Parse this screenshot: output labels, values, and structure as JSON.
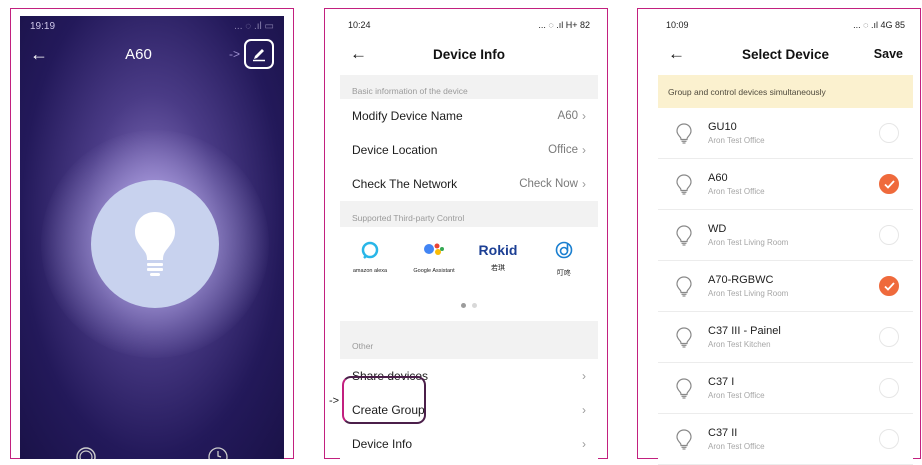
{
  "screen1": {
    "status_time": "19:19",
    "title": "A60",
    "arrow_note": "->"
  },
  "screen2": {
    "status_time": "10:24",
    "status_right": "... ◌ .ıl H+ 82",
    "title": "Device Info",
    "section_basic": "Basic information of the device",
    "rows_basic": [
      {
        "label": "Modify Device Name",
        "value": "A60"
      },
      {
        "label": "Device Location",
        "value": "Office"
      },
      {
        "label": "Check The Network",
        "value": "Check Now"
      }
    ],
    "section_third": "Supported Third-party Control",
    "third_party": [
      {
        "caption": "amazon alexa"
      },
      {
        "caption": "Google Assistant"
      },
      {
        "logo": "Rokid",
        "caption": "若琪"
      },
      {
        "caption": "叮咚"
      }
    ],
    "section_other": "Other",
    "rows_other": [
      {
        "label": "Share devices"
      },
      {
        "label": "Create Group"
      },
      {
        "label": "Device Info"
      }
    ],
    "arrow_note": "->"
  },
  "screen3": {
    "status_time": "10:09",
    "status_right": "... ◌ .ıl 4G 85",
    "title": "Select Device",
    "save": "Save",
    "banner": "Group and control devices simultaneously",
    "devices": [
      {
        "name": "GU10",
        "location": "Aron Test  Office",
        "selected": false
      },
      {
        "name": "A60",
        "location": "Aron Test  Office",
        "selected": true
      },
      {
        "name": "WD",
        "location": "Aron Test  Living Room",
        "selected": false
      },
      {
        "name": "A70-RGBWC",
        "location": "Aron Test  Living Room",
        "selected": true
      },
      {
        "name": "C37 III - Painel",
        "location": "Aron Test  Kitchen",
        "selected": false
      },
      {
        "name": "C37 I",
        "location": "Aron Test  Office",
        "selected": false
      },
      {
        "name": "C37 II",
        "location": "Aron Test  Office",
        "selected": false
      }
    ]
  },
  "colors": {
    "frame": "#c2207f",
    "accent_check": "#ef6a3c",
    "banner_bg": "#fbf1cf"
  }
}
